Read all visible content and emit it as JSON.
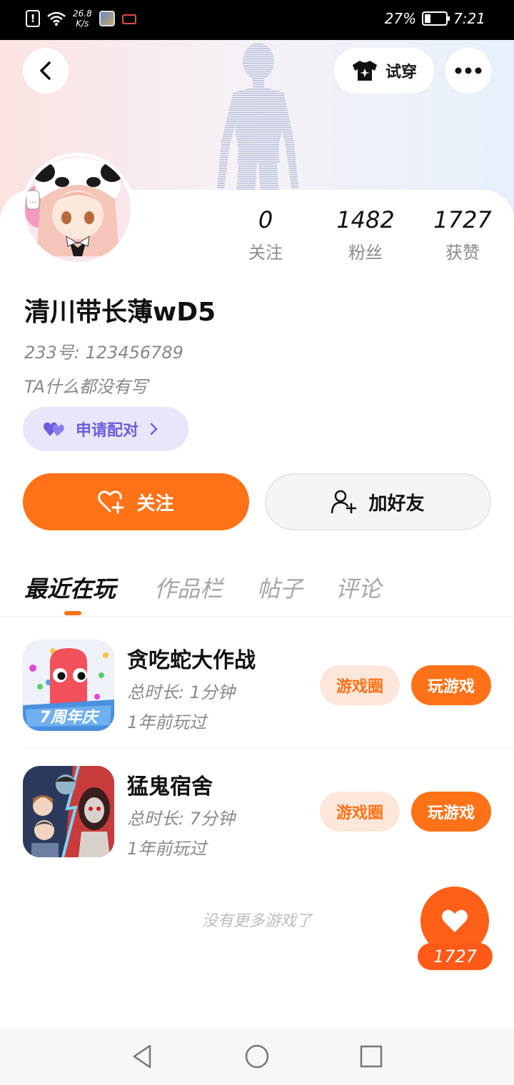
{
  "status_bar": {
    "net_speed_value": "26.8",
    "net_speed_unit": "K/s",
    "battery": "27%",
    "battery_level": 0.27,
    "time": "7:21"
  },
  "header": {
    "try_on_label": "试穿"
  },
  "profile": {
    "stats": [
      {
        "value": "0",
        "label": "关注"
      },
      {
        "value": "1482",
        "label": "粉丝"
      },
      {
        "value": "1727",
        "label": "获赞"
      }
    ],
    "username": "清川带长薄wD5",
    "id_line": "233号:  123456789",
    "bio": "TA什么都没有写",
    "pair_label": "申请配对",
    "follow_label": "关注",
    "add_friend_label": "加好友"
  },
  "tabs": [
    {
      "label": "最近在玩",
      "active": true
    },
    {
      "label": "作品栏",
      "active": false
    },
    {
      "label": "帖子",
      "active": false
    },
    {
      "label": "评论",
      "active": false
    }
  ],
  "games": [
    {
      "name": "贪吃蛇大作战",
      "duration": "总时长:  1分钟",
      "last_played": "1年前玩过",
      "icon_badge": "7周年庆",
      "circle_label": "游戏圈",
      "play_label": "玩游戏"
    },
    {
      "name": "猛鬼宿舍",
      "duration": "总时长:  7分钟",
      "last_played": "1年前玩过",
      "circle_label": "游戏圈",
      "play_label": "玩游戏"
    }
  ],
  "no_more_text": "没有更多游戏了",
  "like_count": "1727",
  "colors": {
    "accent": "#ff7217",
    "pair_bg": "#e9e6fb",
    "pair_text": "#6d5ee0"
  }
}
